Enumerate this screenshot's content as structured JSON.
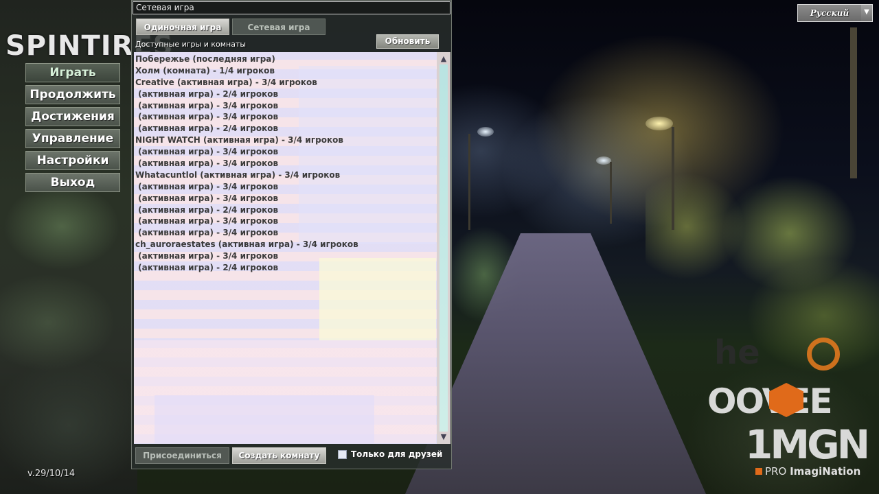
{
  "logo": {
    "text": "SPINTIRES"
  },
  "main_menu": [
    {
      "label": "Играть"
    },
    {
      "label": "Продолжить"
    },
    {
      "label": "Достижения"
    },
    {
      "label": "Управление"
    },
    {
      "label": "Настройки"
    },
    {
      "label": "Выход"
    }
  ],
  "version": "v.29/10/14",
  "language_select": {
    "value": "Русский",
    "arrow_icon": "chevron-down-icon"
  },
  "dialog": {
    "title": "Сетевая игра",
    "tabs": [
      {
        "label": "Одиночная игра",
        "selected": true
      },
      {
        "label": "Сетевая игра",
        "selected": false
      }
    ],
    "refresh_label": "Обновить",
    "list_header": "Доступные игры и комнаты",
    "rows": [
      "Побережье (последняя игра)",
      "Холм (комната) - 1/4 игроков",
      "Creative (активная игра) - 3/4 игроков",
      " (активная игра) - 2/4 игроков",
      " (активная игра) - 3/4 игроков",
      " (активная игра) - 3/4 игроков",
      " (активная игра) - 2/4 игроков",
      "NIGHT WATCH (активная игра) - 3/4 игроков",
      " (активная игра) - 3/4 игроков",
      " (активная игра) - 3/4 игроков",
      "Whatacuntlol (активная игра) - 3/4 игроков",
      " (активная игра) - 3/4 игроков",
      " (активная игра) - 3/4 игроков",
      " (активная игра) - 2/4 игроков",
      " (активная игра) - 3/4 игроков",
      " (активная игра) - 3/4 игроков",
      "ch_auroraestates (активная игра) - 3/4 игроков",
      " (активная игра) - 3/4 игроков",
      " (активная игра) - 2/4 игроков"
    ],
    "join_label": "Присоединиться",
    "create_label": "Создать комнату",
    "friends_only_label": "Только для друзей",
    "friends_only_checked": false
  },
  "watermarks": {
    "oovee": "OOVEE",
    "mgn": "1MGN",
    "pro_prefix": "PRO",
    "pro_name": "ImagiNation"
  }
}
